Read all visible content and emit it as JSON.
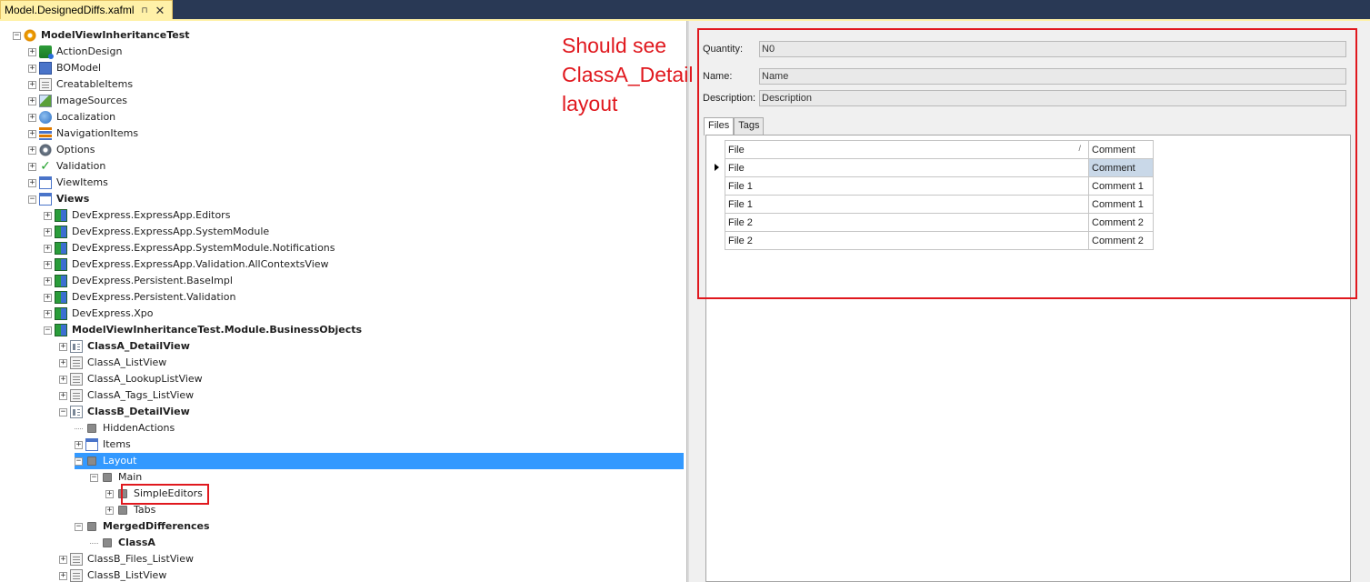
{
  "doc_tab": {
    "title": "Model.DesignedDiffs.xafml",
    "pin_glyph": "⊓",
    "close_glyph": "✕"
  },
  "tree": {
    "nodes": [
      {
        "id": "root",
        "label": "ModelViewInheritanceTest",
        "bold": true,
        "icon": "gear-icon",
        "expander": "−"
      },
      {
        "id": "actiondesign",
        "label": "ActionDesign",
        "bold": false,
        "icon": "action-icon",
        "expander": "+"
      },
      {
        "id": "bomodel",
        "label": "BOModel",
        "bold": false,
        "icon": "bo-model-icon",
        "expander": "+"
      },
      {
        "id": "creatableitems",
        "label": "CreatableItems",
        "bold": false,
        "icon": "list-icon",
        "expander": "+"
      },
      {
        "id": "imagesources",
        "label": "ImageSources",
        "bold": false,
        "icon": "image-icon",
        "expander": "+"
      },
      {
        "id": "localization",
        "label": "Localization",
        "bold": false,
        "icon": "globe-icon",
        "expander": "+"
      },
      {
        "id": "navigationitems",
        "label": "NavigationItems",
        "bold": false,
        "icon": "navigation-icon",
        "expander": "+"
      },
      {
        "id": "options",
        "label": "Options",
        "bold": false,
        "icon": "options-icon",
        "expander": "+"
      },
      {
        "id": "validation",
        "label": "Validation",
        "bold": false,
        "icon": "check-icon",
        "expander": "+"
      },
      {
        "id": "viewitems",
        "label": "ViewItems",
        "bold": false,
        "icon": "view-items-icon",
        "expander": "+"
      },
      {
        "id": "views",
        "label": "Views",
        "bold": true,
        "icon": "views-icon",
        "expander": "−"
      },
      {
        "id": "m-editors",
        "label": "DevExpress.ExpressApp.Editors",
        "bold": false,
        "icon": "module-icon",
        "expander": "+"
      },
      {
        "id": "m-system",
        "label": "DevExpress.ExpressApp.SystemModule",
        "bold": false,
        "icon": "module-icon",
        "expander": "+"
      },
      {
        "id": "m-notif",
        "label": "DevExpress.ExpressApp.SystemModule.Notifications",
        "bold": false,
        "icon": "module-icon",
        "expander": "+"
      },
      {
        "id": "m-valid",
        "label": "DevExpress.ExpressApp.Validation.AllContextsView",
        "bold": false,
        "icon": "module-icon",
        "expander": "+"
      },
      {
        "id": "m-baseimpl",
        "label": "DevExpress.Persistent.BaseImpl",
        "bold": false,
        "icon": "module-icon",
        "expander": "+"
      },
      {
        "id": "m-pvalid",
        "label": "DevExpress.Persistent.Validation",
        "bold": false,
        "icon": "module-icon",
        "expander": "+"
      },
      {
        "id": "m-xpo",
        "label": "DevExpress.Xpo",
        "bold": false,
        "icon": "module-icon",
        "expander": "+"
      },
      {
        "id": "m-bo",
        "label": "ModelViewInheritanceTest.Module.BusinessObjects",
        "bold": true,
        "icon": "module-icon",
        "expander": "−"
      },
      {
        "id": "classa-detail",
        "label": "ClassA_DetailView",
        "bold": true,
        "icon": "detail-view-icon",
        "expander": "+"
      },
      {
        "id": "classa-list",
        "label": "ClassA_ListView",
        "bold": false,
        "icon": "list-view-icon",
        "expander": "+"
      },
      {
        "id": "classa-lookup",
        "label": "ClassA_LookupListView",
        "bold": false,
        "icon": "list-view-icon",
        "expander": "+"
      },
      {
        "id": "classa-tags",
        "label": "ClassA_Tags_ListView",
        "bold": false,
        "icon": "list-view-icon",
        "expander": "+"
      },
      {
        "id": "classb-detail",
        "label": "ClassB_DetailView",
        "bold": true,
        "icon": "detail-view-icon",
        "expander": "−"
      },
      {
        "id": "hiddenactions",
        "label": "HiddenActions",
        "bold": false,
        "icon": "node-icon",
        "expander": ""
      },
      {
        "id": "items",
        "label": "Items",
        "bold": false,
        "icon": "view-items-icon",
        "expander": "+"
      },
      {
        "id": "layout",
        "label": "Layout",
        "bold": false,
        "icon": "node-icon",
        "expander": "−",
        "selected": true
      },
      {
        "id": "main",
        "label": "Main",
        "bold": false,
        "icon": "node-icon",
        "expander": "−"
      },
      {
        "id": "simpleeditors",
        "label": "SimpleEditors",
        "bold": false,
        "icon": "node-icon",
        "expander": "+"
      },
      {
        "id": "tabs",
        "label": "Tabs",
        "bold": false,
        "icon": "node-icon",
        "expander": "+"
      },
      {
        "id": "mergeddiff",
        "label": "MergedDifferences",
        "bold": true,
        "icon": "node-icon",
        "expander": "−"
      },
      {
        "id": "classa",
        "label": "ClassA",
        "bold": true,
        "icon": "node-icon",
        "expander": ""
      },
      {
        "id": "classb-files",
        "label": "ClassB_Files_ListView",
        "bold": false,
        "icon": "list-view-icon",
        "expander": "+"
      },
      {
        "id": "classb-list",
        "label": "ClassB_ListView",
        "bold": false,
        "icon": "list-view-icon",
        "expander": "+"
      }
    ]
  },
  "detail": {
    "fields": [
      {
        "label": "Quantity:",
        "value": "N0"
      },
      {
        "label": "Name:",
        "value": "Name"
      },
      {
        "label": "Description:",
        "value": "Description"
      }
    ],
    "tabs": [
      {
        "label": "Files",
        "active": true
      },
      {
        "label": "Tags",
        "active": false
      }
    ],
    "grid": {
      "columns": [
        "File",
        "Comment"
      ],
      "sort_glyph": "/",
      "rows": [
        [
          "File",
          "Comment"
        ],
        [
          "File 1",
          "Comment 1"
        ],
        [
          "File 1",
          "Comment 1"
        ],
        [
          "File 2",
          "Comment 2"
        ],
        [
          "File 2",
          "Comment 2"
        ]
      ]
    }
  },
  "annotation": {
    "lines": [
      "Should see",
      "ClassA_Detail",
      "layout"
    ],
    "color": "#e0181e"
  },
  "colors": {
    "tab_background": "#fff1a8",
    "titlebar": "#293955",
    "selection": "#3399ff",
    "annotation_red": "#e0181e"
  }
}
